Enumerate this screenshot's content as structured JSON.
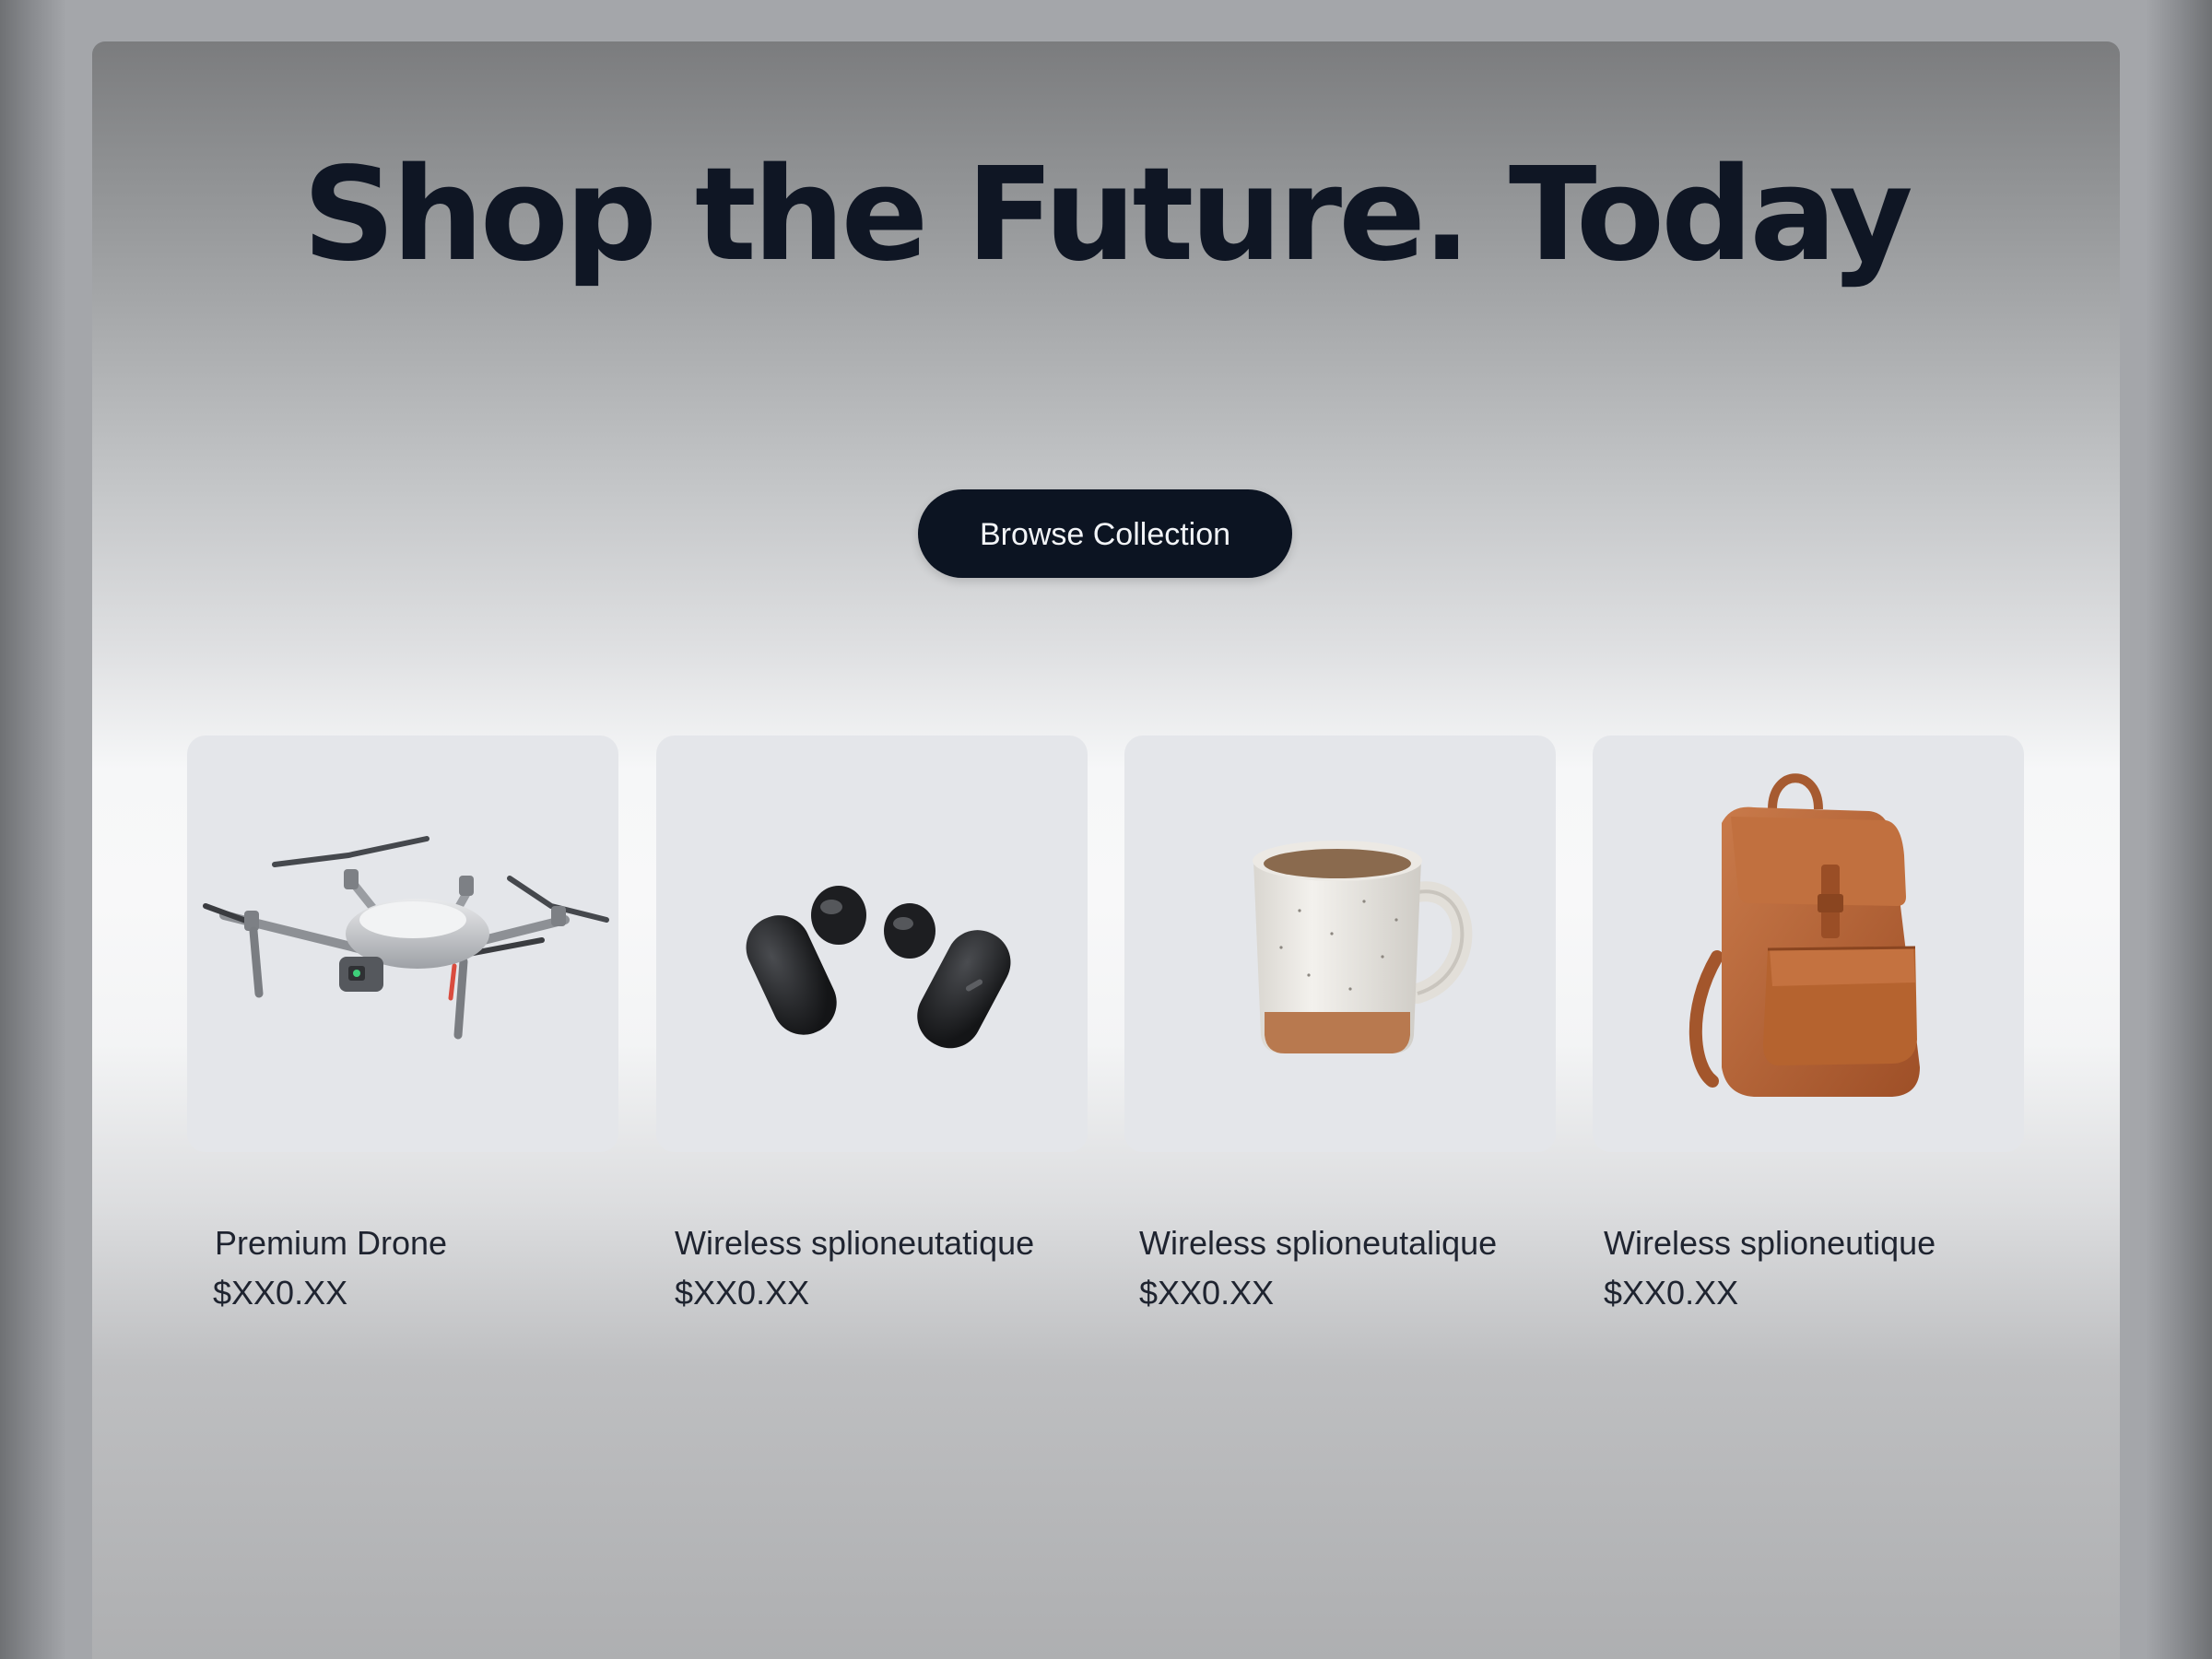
{
  "hero": {
    "title": "Shop the Future. Today"
  },
  "cta": {
    "label": "Browse Collection"
  },
  "products": [
    {
      "name": "Premium Drone",
      "price": "$XX0.XX",
      "icon": "drone-image"
    },
    {
      "name": "Wireless splioneutatique",
      "price": "$XX0.XX",
      "icon": "earbuds-image"
    },
    {
      "name": "Wireless splioneutalique",
      "price": "$XX0.XX",
      "icon": "mug-image"
    },
    {
      "name": "Wireless splioneutique",
      "price": "$XX0.XX",
      "icon": "backpack-image"
    }
  ],
  "colors": {
    "title": "#0f1624",
    "button_bg": "#0c1422",
    "button_text": "#f2f4f7",
    "card_bg": "#e4e6ea",
    "backpack_leather": "#b8653a"
  }
}
